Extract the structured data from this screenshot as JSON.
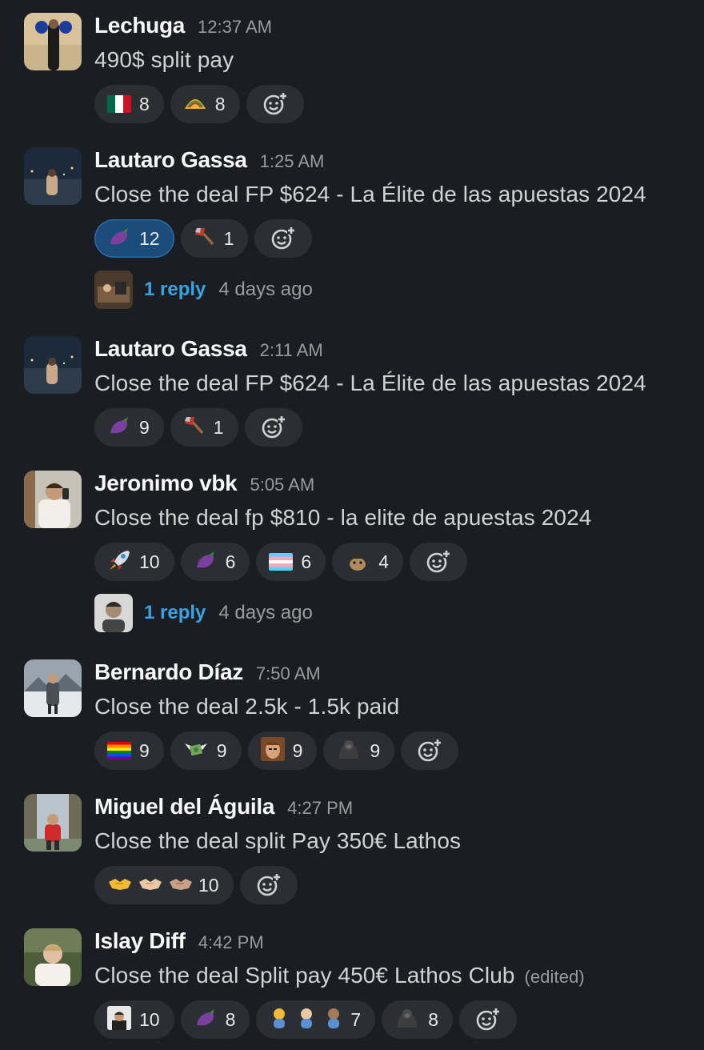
{
  "messages": [
    {
      "name": "Lechuga",
      "time": "12:37 AM",
      "text": "490$ split pay",
      "edited": "",
      "reactions": [
        {
          "emoji": "mexico-flag",
          "count": "8",
          "mine": false
        },
        {
          "emoji": "taco",
          "count": "8",
          "mine": false
        }
      ]
    },
    {
      "name": "Lautaro Gassa",
      "time": "1:25 AM",
      "text": "Close the deal FP $624 - La Élite de las apuestas 2024",
      "edited": "",
      "reactions": [
        {
          "emoji": "eggplant",
          "count": "12",
          "mine": true
        },
        {
          "emoji": "axe",
          "count": "1",
          "mine": false
        }
      ],
      "thread": {
        "replies": "1 reply",
        "last": "4 days ago"
      }
    },
    {
      "name": "Lautaro Gassa",
      "time": "2:11 AM",
      "text": "Close the deal FP $624 - La Élite de las apuestas 2024",
      "edited": "",
      "reactions": [
        {
          "emoji": "eggplant",
          "count": "9",
          "mine": false
        },
        {
          "emoji": "axe",
          "count": "1",
          "mine": false
        }
      ]
    },
    {
      "name": "Jeronimo vbk",
      "time": "5:05 AM",
      "text": "Close the deal fp $810 - la elite de apuestas 2024",
      "edited": "",
      "reactions": [
        {
          "emoji": "rocket",
          "count": "10",
          "mine": false
        },
        {
          "emoji": "eggplant",
          "count": "6",
          "mine": false
        },
        {
          "emoji": "transgender-flag",
          "count": "6",
          "mine": false
        },
        {
          "emoji": "custom-detective",
          "count": "4",
          "mine": false
        }
      ],
      "thread": {
        "replies": "1 reply",
        "last": "4 days ago"
      }
    },
    {
      "name": "Bernardo Díaz",
      "time": "7:50 AM",
      "text": "Close the deal 2.5k - 1.5k paid",
      "edited": "",
      "reactions": [
        {
          "emoji": "rainbow-flag",
          "count": "9",
          "mine": false
        },
        {
          "emoji": "money-with-wings",
          "count": "9",
          "mine": false
        },
        {
          "emoji": "custom-face",
          "count": "9",
          "mine": false
        },
        {
          "emoji": "gorilla",
          "count": "9",
          "mine": false
        }
      ]
    },
    {
      "name": "Miguel del Águila",
      "time": "4:27 PM",
      "text": "Close the deal split Pay 350€ Lathos",
      "edited": "",
      "reactions": [
        {
          "emoji": "handshake-multi-skin-tone",
          "count": "10",
          "mine": false
        }
      ]
    },
    {
      "name": "Islay Diff",
      "time": "4:42 PM",
      "text": "Close the deal Split pay 450€ Lathos Club",
      "edited": "(edited)",
      "reactions": [
        {
          "emoji": "custom-portrait",
          "count": "10",
          "mine": false
        },
        {
          "emoji": "eggplant",
          "count": "8",
          "mine": false
        },
        {
          "emoji": "baby-multi-skin-tone",
          "count": "7",
          "mine": false
        },
        {
          "emoji": "gorilla",
          "count": "8",
          "mine": false
        }
      ]
    }
  ],
  "colors": {
    "background": "#1a1d21",
    "pill": "#2b2e33",
    "pill_mine": "#1c4d7a",
    "link": "#3aa3e3",
    "muted": "#9a9b9d"
  }
}
